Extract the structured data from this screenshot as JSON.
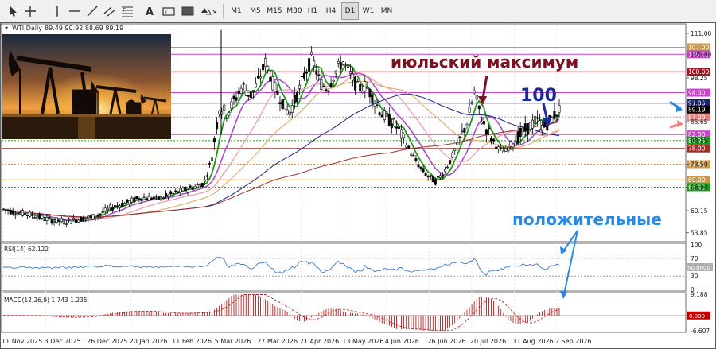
{
  "toolbar": {
    "timeframes": [
      "M1",
      "M5",
      "M15",
      "M30",
      "H1",
      "H4",
      "D1",
      "W1",
      "MN"
    ],
    "active_timeframe": "D1",
    "icons": [
      "cursor-icon",
      "crosshair-icon",
      "vertical-line-icon",
      "horizontal-line-icon",
      "trendline-icon",
      "equidistant-channel-icon",
      "fibonacci-icon",
      "text-icon",
      "label-icon",
      "shapes-icon"
    ]
  },
  "chart_header": {
    "symbol": "WTI,Daily",
    "ohlc": "89.49 90.92 88.69 89.19"
  },
  "annotations": {
    "july_high": "июльский максимум",
    "level_100": "100",
    "positive": "положительные"
  },
  "colors": {
    "candle": "#000000",
    "ma_green": "#1a9a1a",
    "ma_purple": "#a64fc8",
    "ma_pink": "#e8a6b0",
    "ma_orange": "#e0b070",
    "ma_navy": "#1a237e",
    "ma_brown": "#a0302a",
    "level_magenta": "#cc44cc",
    "level_darkred": "#a01828",
    "annotation_darkred": "#7a1020",
    "annotation_blue": "#1e6fd0",
    "arrow_blue": "#2a8ae0",
    "rsi_line": "#3a7ad0",
    "macd_hist": "#b00000",
    "macd_signal": "#c02020"
  },
  "chart_data": {
    "type": "candlestick",
    "symbol": "WTI",
    "timeframe": "Daily",
    "last": {
      "open": 89.49,
      "high": 90.92,
      "low": 88.69,
      "close": 89.19
    },
    "x_tick_labels": [
      "11 Nov 2025",
      "3 Dec 2025",
      "26 Dec 2025",
      "20 Jan 2026",
      "11 Feb 2026",
      "5 Mar 2026",
      "27 Mar 2026",
      "21 Apr 2026",
      "13 May 2026",
      "4 Jun 2026",
      "26 Jun 2026",
      "20 Jul 2026",
      "11 Aug 2026",
      "2 Sep 2026"
    ],
    "y_tick_labels": [
      "111.00",
      "105.00",
      "98.25",
      "91.50",
      "85.65",
      "80.25",
      "73.50",
      "66.90",
      "60.15",
      "53.85"
    ],
    "ylim": [
      51.5,
      113.5
    ],
    "horizontal_levels": [
      {
        "value": 107.0,
        "label": "107.00",
        "color": "#c89a50",
        "style": "solid"
      },
      {
        "value": 105.0,
        "label": "105.00",
        "color": "#cc44cc",
        "style": "solid"
      },
      {
        "value": 100.0,
        "label": "100.00",
        "color": "#a01828",
        "style": "solid"
      },
      {
        "value": 94.0,
        "label": "94.00",
        "color": "#cc44cc",
        "style": "solid"
      },
      {
        "value": 91.0,
        "label": "91.00",
        "color": "#1a237e",
        "style": "solid"
      },
      {
        "value": 87.0,
        "label": "87.00",
        "color": "#e88080",
        "style": "dotted"
      },
      {
        "value": 82.0,
        "label": "82.00",
        "color": "#cc44cc",
        "style": "solid"
      },
      {
        "value": 80.25,
        "label": "80.25",
        "color": "#1a9a1a",
        "style": "dotted"
      },
      {
        "value": 78.0,
        "label": "78.00",
        "color": "#a0302a",
        "style": "solid"
      },
      {
        "value": 73.5,
        "label": "73.50",
        "color": "#c89a50",
        "style": "dotted"
      },
      {
        "value": 69.0,
        "label": "69.00",
        "color": "#c89a50",
        "style": "solid"
      },
      {
        "value": 66.9,
        "label": "66.90",
        "color": "#1a9a1a",
        "style": "dotted"
      }
    ],
    "price_path": [
      {
        "x": 0,
        "y": 60.5
      },
      {
        "x": 4,
        "y": 59.5
      },
      {
        "x": 8,
        "y": 58.8
      },
      {
        "x": 12,
        "y": 57.5
      },
      {
        "x": 16,
        "y": 57.0
      },
      {
        "x": 20,
        "y": 57.8
      },
      {
        "x": 24,
        "y": 58.5
      },
      {
        "x": 28,
        "y": 61.0
      },
      {
        "x": 32,
        "y": 62.5
      },
      {
        "x": 36,
        "y": 64.0
      },
      {
        "x": 40,
        "y": 63.5
      },
      {
        "x": 44,
        "y": 65.0
      },
      {
        "x": 48,
        "y": 66.5
      },
      {
        "x": 52,
        "y": 68.0
      },
      {
        "x": 54,
        "y": 75.0
      },
      {
        "x": 56,
        "y": 90.0
      },
      {
        "x": 58,
        "y": 88.0
      },
      {
        "x": 60,
        "y": 92.0
      },
      {
        "x": 62,
        "y": 96.0
      },
      {
        "x": 64,
        "y": 93.0
      },
      {
        "x": 66,
        "y": 97.0
      },
      {
        "x": 68,
        "y": 103.0
      },
      {
        "x": 70,
        "y": 96.0
      },
      {
        "x": 72,
        "y": 92.0
      },
      {
        "x": 74,
        "y": 88.0
      },
      {
        "x": 76,
        "y": 93.0
      },
      {
        "x": 78,
        "y": 99.0
      },
      {
        "x": 80,
        "y": 104.0
      },
      {
        "x": 82,
        "y": 97.0
      },
      {
        "x": 84,
        "y": 95.0
      },
      {
        "x": 86,
        "y": 100.0
      },
      {
        "x": 88,
        "y": 103.0
      },
      {
        "x": 90,
        "y": 99.0
      },
      {
        "x": 92,
        "y": 95.0
      },
      {
        "x": 94,
        "y": 96.0
      },
      {
        "x": 96,
        "y": 92.0
      },
      {
        "x": 98,
        "y": 88.0
      },
      {
        "x": 100,
        "y": 86.0
      },
      {
        "x": 102,
        "y": 84.0
      },
      {
        "x": 104,
        "y": 80.0
      },
      {
        "x": 106,
        "y": 76.0
      },
      {
        "x": 108,
        "y": 72.5
      },
      {
        "x": 110,
        "y": 70.0
      },
      {
        "x": 112,
        "y": 68.5
      },
      {
        "x": 114,
        "y": 71.0
      },
      {
        "x": 116,
        "y": 75.0
      },
      {
        "x": 118,
        "y": 80.0
      },
      {
        "x": 120,
        "y": 85.0
      },
      {
        "x": 122,
        "y": 94.0
      },
      {
        "x": 124,
        "y": 86.0
      },
      {
        "x": 126,
        "y": 82.0
      },
      {
        "x": 128,
        "y": 78.0
      },
      {
        "x": 130,
        "y": 77.0
      },
      {
        "x": 132,
        "y": 80.0
      },
      {
        "x": 134,
        "y": 82.0
      },
      {
        "x": 136,
        "y": 84.0
      },
      {
        "x": 138,
        "y": 86.0
      },
      {
        "x": 140,
        "y": 84.0
      },
      {
        "x": 142,
        "y": 86.5
      },
      {
        "x": 144,
        "y": 89.2
      }
    ],
    "indicators": [
      {
        "name": "RSI(14)",
        "value": 62.122,
        "levels": [
          30,
          70
        ],
        "ylim": [
          0,
          100
        ],
        "ticks": [
          "100",
          "70",
          "30",
          "0"
        ],
        "right_label": "50.0000"
      },
      {
        "name": "MACD(12,26,9)",
        "values": [
          1.743,
          1.235
        ],
        "ticks": [
          "9.188",
          "0",
          "-6.607"
        ],
        "right_label": "0.000"
      }
    ]
  }
}
